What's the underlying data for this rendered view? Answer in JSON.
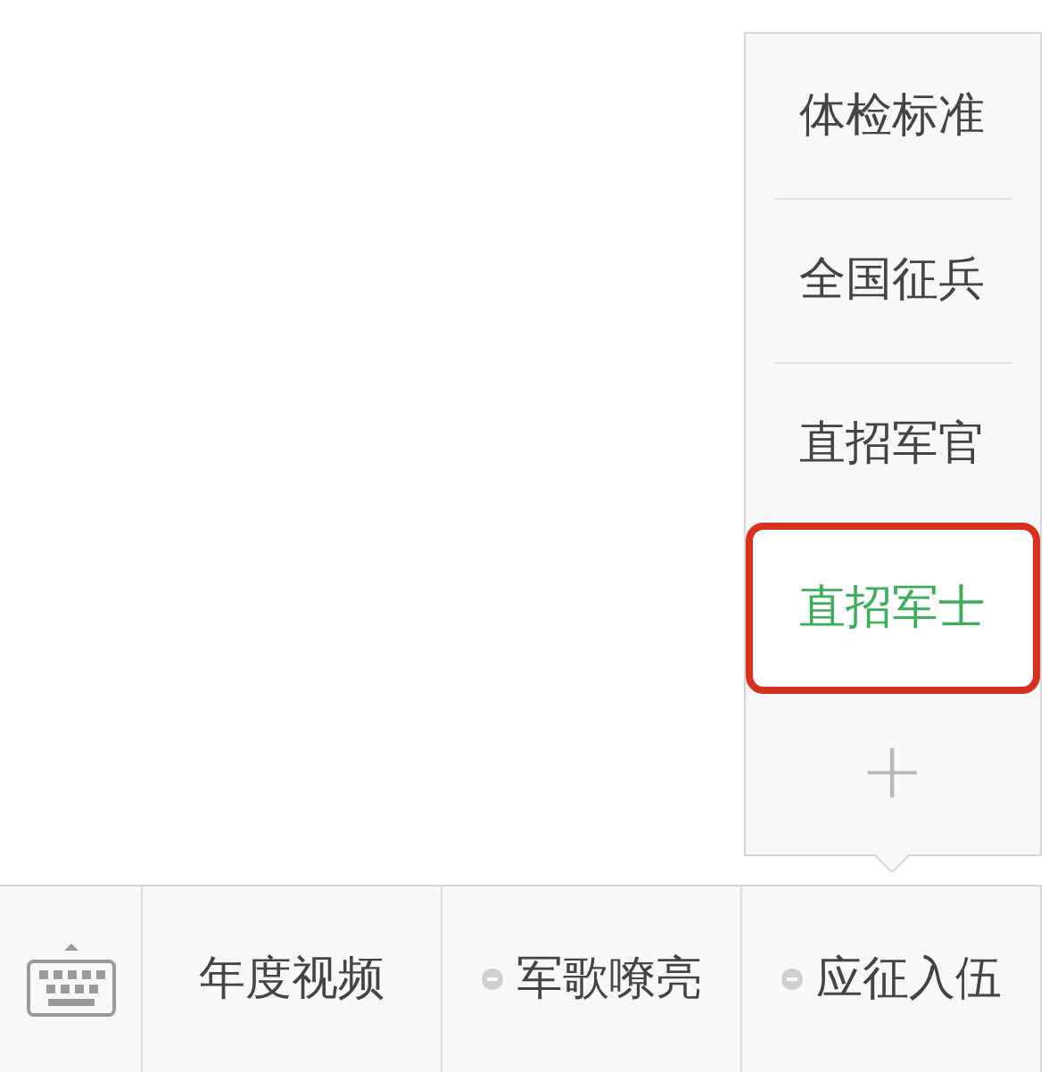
{
  "submenu": {
    "items": [
      {
        "label": "体检标准",
        "selected": false,
        "highlighted": false
      },
      {
        "label": "全国征兵",
        "selected": false,
        "highlighted": false
      },
      {
        "label": "直招军官",
        "selected": false,
        "highlighted": false
      },
      {
        "label": "直招军士",
        "selected": true,
        "highlighted": true
      }
    ],
    "add_label": "+"
  },
  "menu_bar": {
    "items": [
      {
        "label": "年度视频",
        "kind": "plain",
        "open": false
      },
      {
        "label": "军歌嘹亮",
        "kind": "submenu",
        "open": false
      },
      {
        "label": "应征入伍",
        "kind": "submenu",
        "open": true
      }
    ]
  }
}
